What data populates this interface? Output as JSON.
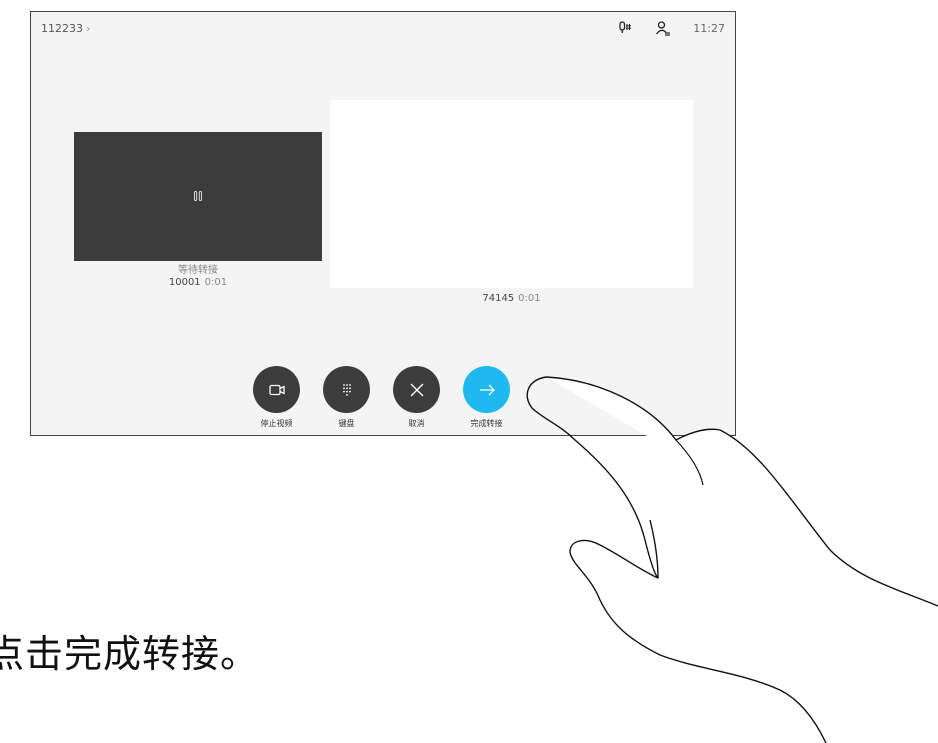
{
  "topbar": {
    "call_id": "112233",
    "chevron": "›",
    "mic_icon": "mic-hash-icon",
    "contact_icon": "contact-list-icon",
    "time": "11:27"
  },
  "held_call": {
    "status": "等待转接",
    "number": "10001",
    "duration": "0:01",
    "icon": "pause-icon"
  },
  "active_call": {
    "number": "74145",
    "duration": "0:01"
  },
  "controls": [
    {
      "label": "停止视频",
      "icon": "camera-icon"
    },
    {
      "label": "键盘",
      "icon": "keypad-icon"
    },
    {
      "label": "取消",
      "icon": "close-icon"
    },
    {
      "label": "完成转接",
      "icon": "arrow-right-icon"
    }
  ],
  "instruction": "点击完成转接。",
  "colors": {
    "accent": "#1fb9ef",
    "button_dark": "#3c3c3c",
    "screen_bg": "#f4f4f4"
  }
}
